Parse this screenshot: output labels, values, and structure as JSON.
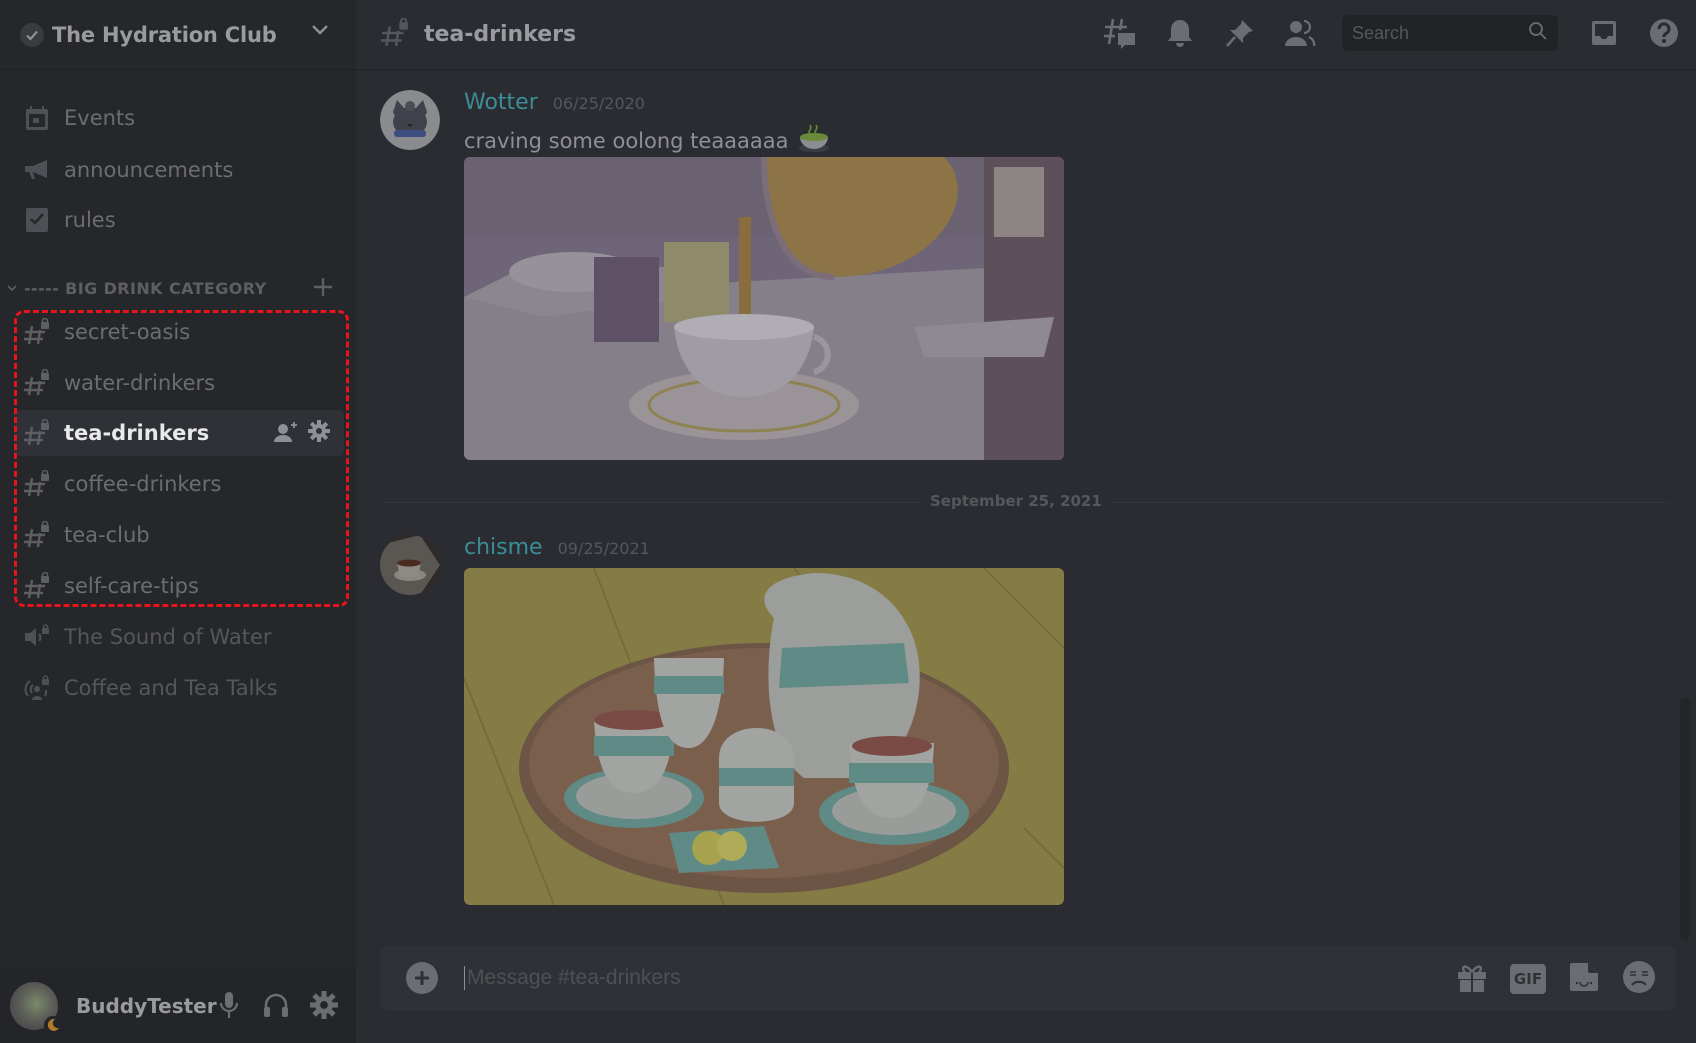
{
  "server": {
    "name": "The Hydration Club",
    "verified": true
  },
  "sidebar": {
    "top_items": [
      {
        "label": "Events",
        "icon": "calendar-icon"
      },
      {
        "label": "announcements",
        "icon": "megaphone-icon"
      },
      {
        "label": "rules",
        "icon": "rules-checkbox-icon"
      }
    ],
    "category": {
      "label": "----- BIG DRINK CATEGORY",
      "collapsed": false
    },
    "channels": [
      {
        "label": "secret-oasis",
        "icon": "locked-text-channel-icon",
        "selected": false
      },
      {
        "label": "water-drinkers",
        "icon": "locked-text-channel-icon",
        "selected": false
      },
      {
        "label": "tea-drinkers",
        "icon": "locked-text-channel-icon",
        "selected": true
      },
      {
        "label": "coffee-drinkers",
        "icon": "locked-text-channel-icon",
        "selected": false
      },
      {
        "label": "tea-club",
        "icon": "locked-text-channel-icon",
        "selected": false
      },
      {
        "label": "self-care-tips",
        "icon": "locked-text-channel-icon",
        "selected": false
      }
    ],
    "voice_channels": [
      {
        "label": "The Sound of Water",
        "icon": "locked-voice-channel-icon"
      },
      {
        "label": "Coffee and Tea Talks",
        "icon": "locked-stage-channel-icon"
      }
    ],
    "highlight_color": "#e8141a"
  },
  "user_panel": {
    "username": "BuddyTester",
    "status": "idle"
  },
  "chat": {
    "channel_name": "tea-drinkers",
    "search_placeholder": "Search",
    "messages": [
      {
        "author": "Wotter",
        "timestamp": "06/25/2020",
        "text": "craving some oolong teaaaaaa",
        "emoji": "green-tea-emoji",
        "attachment": "anime tea pouring into teacup image"
      },
      {
        "author": "chisme",
        "timestamp": "09/25/2021",
        "attachment": "anime tea set on tray image"
      }
    ],
    "date_divider": "September 25, 2021",
    "composer_placeholder": "Message #tea-drinkers",
    "composer_tools": {
      "gif_label": "GIF"
    },
    "author_color": "#3b8e98"
  }
}
